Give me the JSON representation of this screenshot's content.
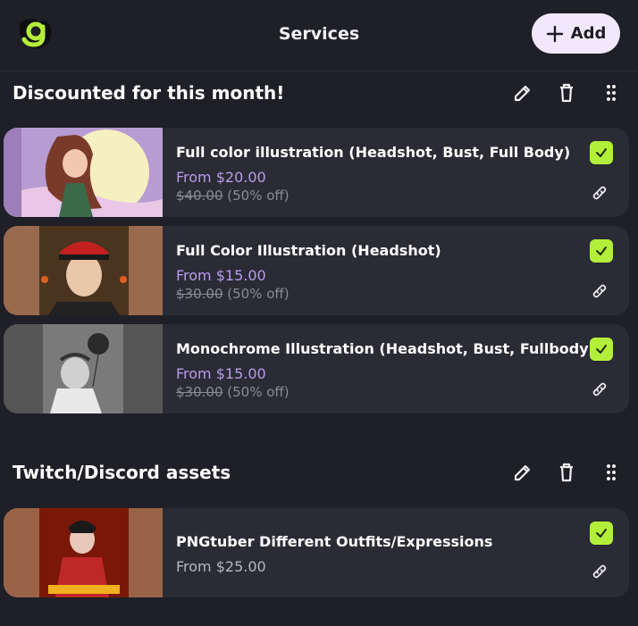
{
  "header": {
    "title": "Services",
    "add_label": "Add"
  },
  "sections": [
    {
      "title": "Discounted for this month!",
      "items": [
        {
          "name": "Full color illustration (Headshot, Bust, Full Body)",
          "price": "From $20.00",
          "old_price": "$40.00",
          "discount": "(50% off)",
          "enabled": true
        },
        {
          "name": "Full Color Illustration (Headshot)",
          "price": "From $15.00",
          "old_price": "$30.00",
          "discount": "(50% off)",
          "enabled": true
        },
        {
          "name": "Monochrome Illustration (Headshot, Bust, Fullbody)",
          "price": "From $15.00",
          "old_price": "$30.00",
          "discount": "(50% off)",
          "enabled": true
        }
      ]
    },
    {
      "title": "Twitch/Discord assets",
      "items": [
        {
          "name": "PNGtuber Different Outfits/Expressions",
          "price": "From $25.00",
          "enabled": true
        }
      ]
    }
  ],
  "colors": {
    "background": "#1e1f27",
    "card": "#2a2b35",
    "accent_green": "#b3ef3a",
    "price_purple": "#b99bea",
    "add_button": "#f1e9fb"
  },
  "icons": [
    "logo-icon",
    "plus-icon",
    "pencil-icon",
    "trash-icon",
    "drag-handle-icon",
    "check-icon",
    "link-icon"
  ]
}
